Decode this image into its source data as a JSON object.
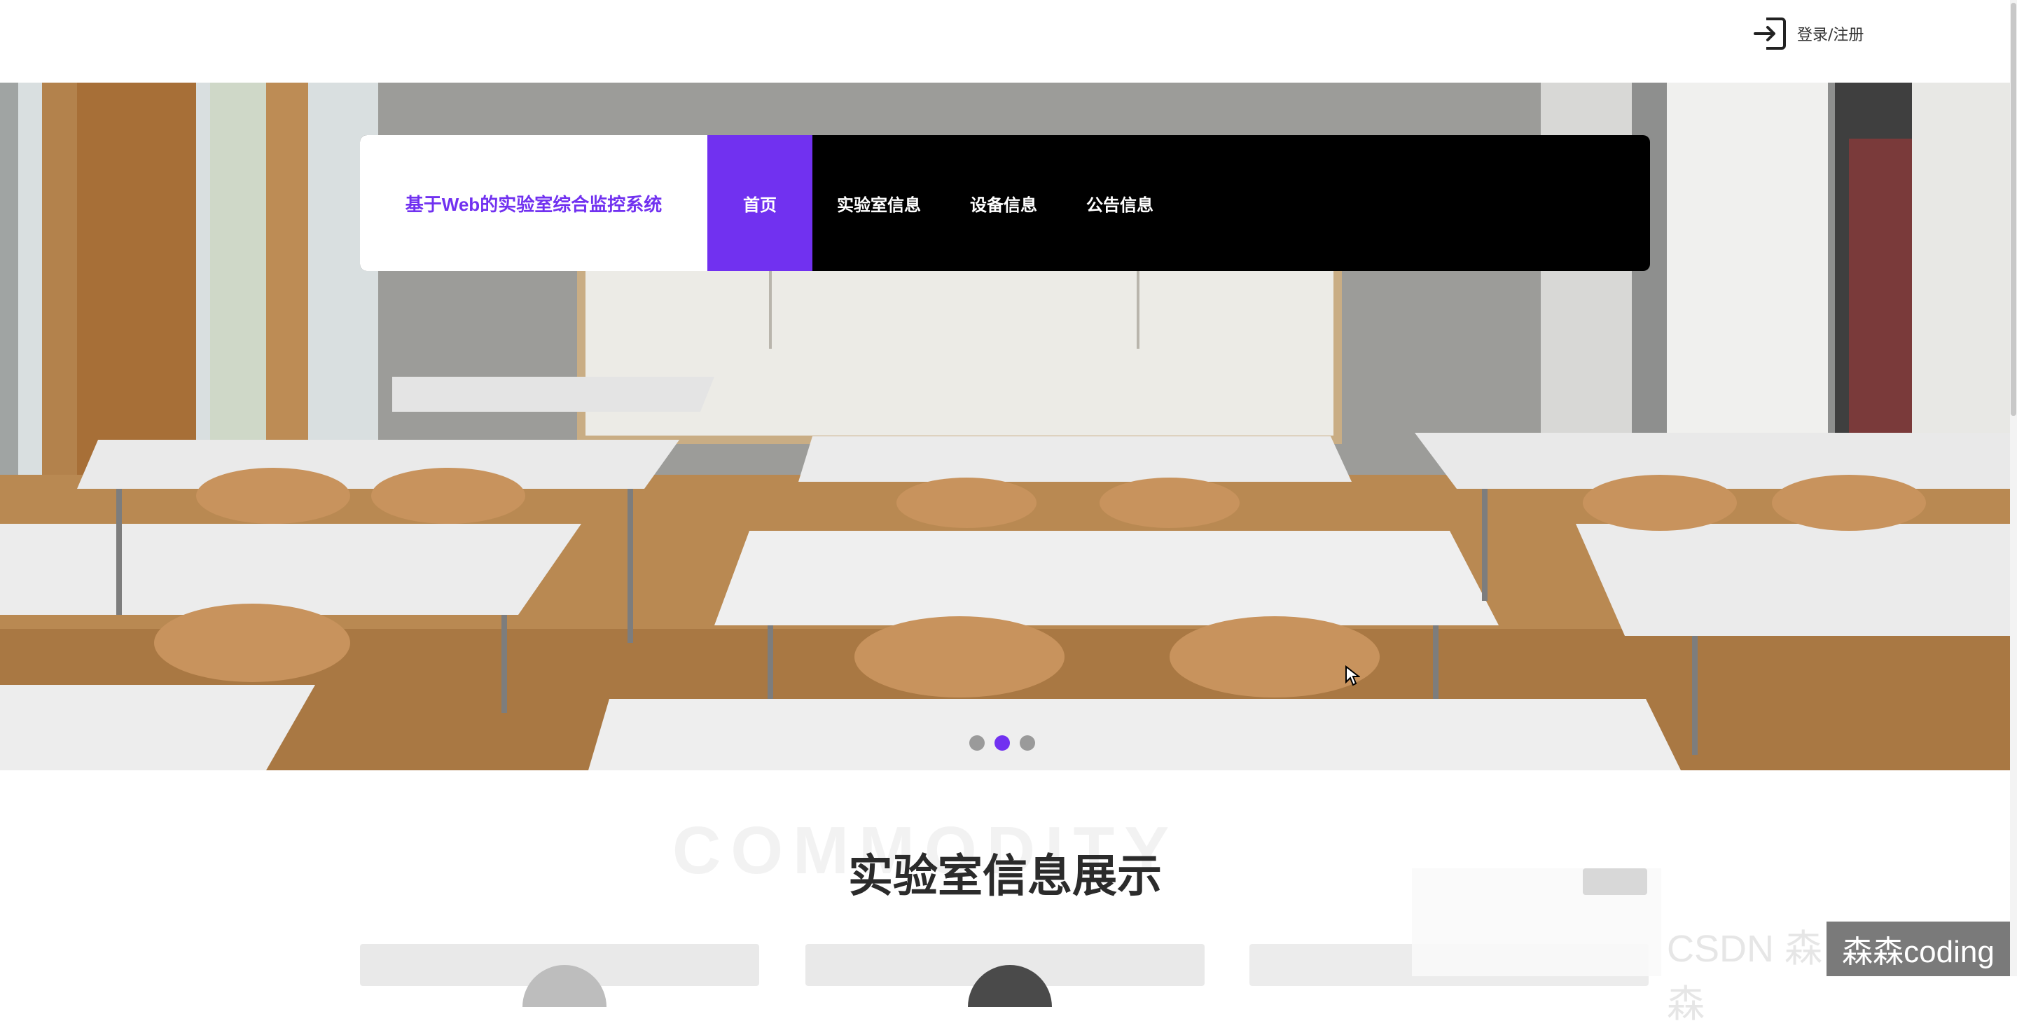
{
  "header": {
    "login_label": "登录/注册",
    "login_icon": "login-arrow-icon"
  },
  "navbar": {
    "brand": "基于Web的实验室综合监控系统",
    "items": [
      {
        "label": "首页",
        "active": true
      },
      {
        "label": "实验室信息"
      },
      {
        "label": "设备信息"
      },
      {
        "label": "公告信息"
      }
    ]
  },
  "carousel": {
    "slide_count": 3,
    "active_index": 1
  },
  "section": {
    "watermark": "COMMODITY",
    "title": "实验室信息展示"
  },
  "blurred": {
    "side_text": "CSDN 森森"
  },
  "overlay_text": "森森coding",
  "colors": {
    "accent": "#7131f0",
    "nav_bg": "#000000",
    "brand_bg": "#ffffff"
  }
}
